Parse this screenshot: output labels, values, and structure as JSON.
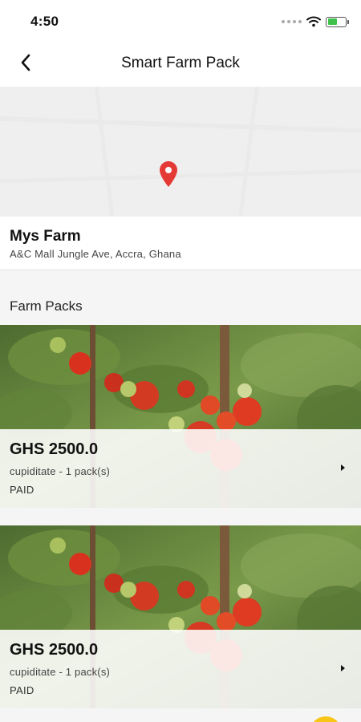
{
  "status_bar": {
    "time": "4:50",
    "battery_level": 0.55,
    "battery_color": "#3ec24b"
  },
  "nav": {
    "title": "Smart Farm Pack",
    "back_icon": "chevron-left-icon"
  },
  "map": {
    "marker_icon": "map-pin-icon",
    "marker_color": "#e53935"
  },
  "farm": {
    "name": "Mys Farm",
    "address": "A&C Mall Jungle Ave, Accra, Ghana"
  },
  "section_title": "Farm Packs",
  "packs": [
    {
      "price": "GHS 2500.0",
      "description": "cupiditate - 1 pack(s)",
      "status": "PAID"
    },
    {
      "price": "GHS 2500.0",
      "description": "cupiditate - 1 pack(s)",
      "status": "PAID"
    }
  ],
  "fab": {
    "color": "#f7c617"
  }
}
